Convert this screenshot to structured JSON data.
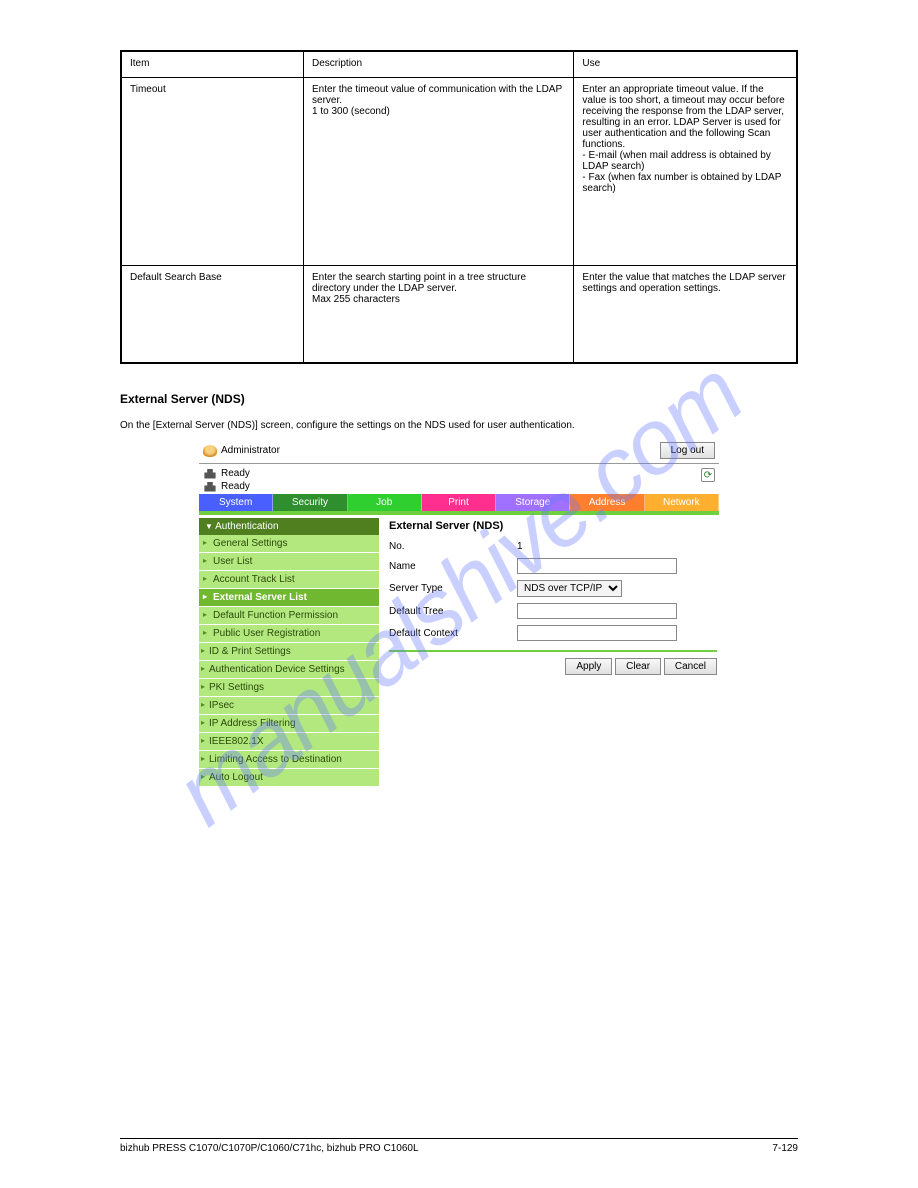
{
  "watermark": "manualshive.com",
  "table_rows": [
    {
      "c1": "Item",
      "c2": "Description",
      "c3": "Use"
    },
    {
      "c1": "Timeout",
      "c2": "Enter the timeout value of communication with the LDAP server.\n1 to 300 (second)",
      "c3": "Enter an appropriate timeout value. If the value is too short, a timeout may occur before receiving the response from the LDAP server, resulting in an error. LDAP Server is used for user authentication and the following Scan functions.\n- E-mail (when mail address is obtained by LDAP search)\n- Fax (when fax number is obtained by LDAP search)"
    },
    {
      "c1": "Default Search Base",
      "c2": "Enter the search starting point in a tree structure directory under the LDAP server.\nMax 255 characters",
      "c3": "Enter the value that matches the LDAP server settings and operation settings."
    }
  ],
  "section_heading": "External Server (NDS)",
  "intro": "On the [External Server (NDS)] screen, configure the settings on the NDS used for user authentication.",
  "ui": {
    "admin_label": "Administrator",
    "logout_label": "Log out",
    "ready1": "Ready",
    "ready2": "Ready",
    "tabs": {
      "system": "System",
      "security": "Security",
      "job": "Job",
      "print": "Print",
      "storage": "Storage",
      "address": "Address",
      "network": "Network"
    },
    "sidebar_section": "Authentication",
    "sidebar_items": [
      "General Settings",
      "User List",
      "Account Track List",
      "External Server List",
      "Default Function Permission",
      "Public User Registration",
      "ID & Print Settings",
      "Authentication Device Settings",
      "PKI Settings",
      "IPsec",
      "IP Address Filtering",
      "IEEE802.1X",
      "Limiting Access to Destination",
      "Auto Logout"
    ],
    "main_title": "External Server (NDS)",
    "form": {
      "no_label": "No.",
      "no_value": "1",
      "name_label": "Name",
      "name_value": "",
      "server_type_label": "Server Type",
      "server_type_value": "NDS over TCP/IP",
      "default_tree_label": "Default Tree",
      "default_tree_value": "",
      "default_context_label": "Default Context",
      "default_context_value": ""
    },
    "buttons": {
      "apply": "Apply",
      "clear": "Clear",
      "cancel": "Cancel"
    }
  },
  "footer": {
    "left": "bizhub PRESS C1070/C1070P/C1060/C71hc, bizhub PRO C1060L",
    "right": "7-129"
  }
}
